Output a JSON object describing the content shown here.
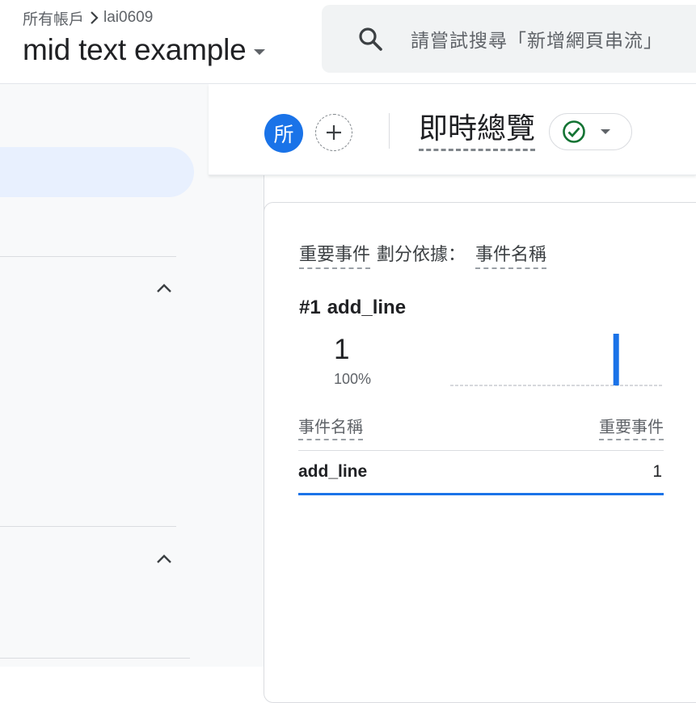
{
  "header": {
    "breadcrumb_root": "所有帳戶",
    "breadcrumb_account": "lai0609",
    "property_name": "mid text example",
    "search_placeholder": "請嘗試搜尋「新增網頁串流」"
  },
  "toolbar": {
    "avatar_label": "所",
    "page_title": "即時總覽",
    "status_color": "#137333"
  },
  "card": {
    "metric_label": "重要事件",
    "split_label": "劃分依據：",
    "dimension_label": "事件名稱",
    "top_rank": "#1",
    "top_event": "add_line",
    "top_value": "1",
    "top_percent": "100%",
    "sparkline": {
      "bar_color": "#1a73e8",
      "values": [
        0,
        0,
        0,
        0,
        0,
        0,
        0,
        0,
        0,
        0,
        0,
        0,
        0,
        0,
        0,
        0,
        0,
        0,
        0,
        0,
        0,
        0,
        0,
        1,
        0,
        0,
        0,
        0,
        0,
        0
      ]
    },
    "table": {
      "col_event": "事件名稱",
      "col_metric": "重要事件",
      "rows": [
        {
          "event": "add_line",
          "count": "1"
        }
      ]
    }
  },
  "colors": {
    "accent": "#1a73e8",
    "sidebar_active": "#e8f0fe"
  }
}
